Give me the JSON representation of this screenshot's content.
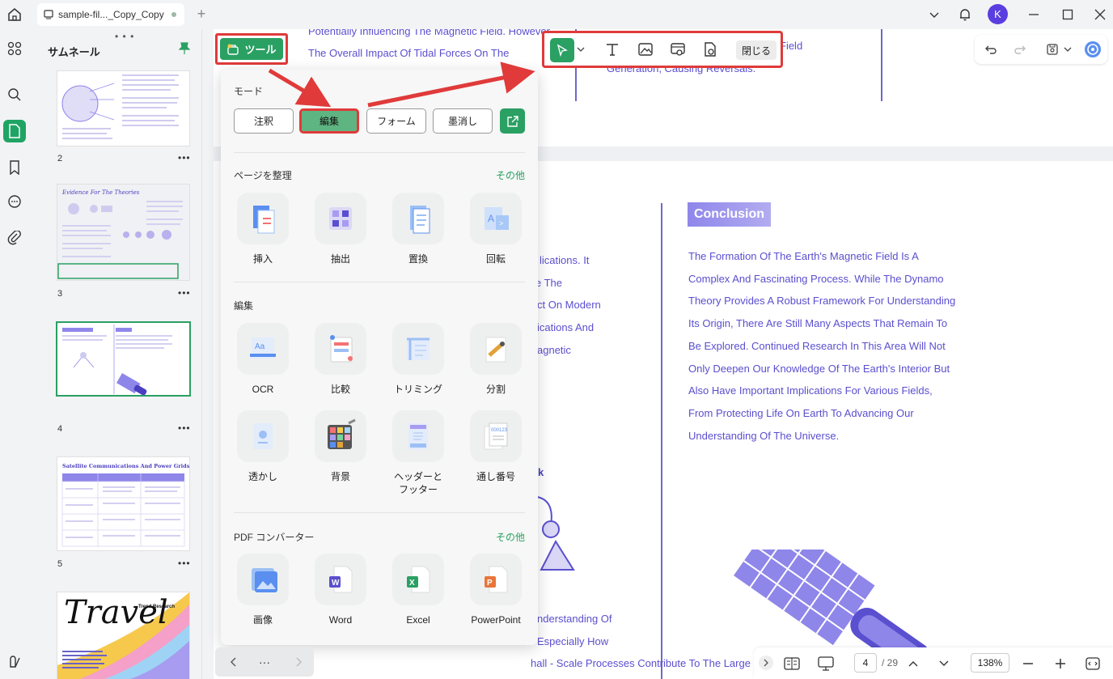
{
  "titlebar": {
    "tab_title": "sample-fil..._Copy_Copy",
    "avatar_letter": "K"
  },
  "thumbnails": {
    "title": "サムネール",
    "pages": [
      {
        "num": "2"
      },
      {
        "num": "3",
        "heading": "Evidence For The Theories"
      },
      {
        "num": "4"
      },
      {
        "num": "5",
        "heading": "Satellite Communications And Power Grids"
      },
      {
        "num": "",
        "heading": "Travel",
        "subheading": "Trend Research"
      }
    ]
  },
  "tool_button": {
    "label": "ツール"
  },
  "edit_toolbar": {
    "close_label": "閉じる"
  },
  "panel": {
    "mode_title": "モード",
    "modes": [
      "注釈",
      "編集",
      "フォーム",
      "墨消し"
    ],
    "organize": {
      "title": "ページを整理",
      "more": "その他",
      "items": [
        "挿入",
        "抽出",
        "置換",
        "回転"
      ]
    },
    "edit": {
      "title": "編集",
      "items": [
        "OCR",
        "比較",
        "トリミング",
        "分割",
        "透かし",
        "背景",
        "ヘッダーと\nフッター",
        "通し番号"
      ]
    },
    "convert": {
      "title": "PDF コンバーター",
      "more": "その他",
      "items": [
        "画像",
        "Word",
        "Excel",
        "PowerPoint"
      ]
    }
  },
  "document": {
    "top_lines": [
      "Potentially Influencing The Magnetic Field. However",
      "The Overall Impact Of Tidal Forces On The"
    ],
    "top_right_lines": [
      "Field",
      "Generation, Causing Reversals."
    ],
    "left_fragments": [
      "lications. It",
      "e The",
      "ct On Modern",
      "ications And",
      "agnetic"
    ],
    "conclusion_title": "Conclusion",
    "conclusion_lines": [
      "The Formation Of The Earth's Magnetic Field Is A",
      "Complex And Fascinating Process. While The Dynamo",
      "Theory Provides A Robust Framework For Understanding",
      "Its Origin, There Are Still Many Aspects That Remain To",
      "Be Explored. Continued Research In This Area Will Not",
      "Only Deepen Our Knowledge Of The Earth's Interior But",
      "Also Have Important Implications For Various Fields,",
      "From Protecting Life On Earth To Advancing Our",
      "Understanding Of The Universe."
    ],
    "bottom_lines": [
      "nderstanding Of",
      "Especially How",
      "hall - Scale Processes Contribute To The Large - Scale Magnetic"
    ],
    "fragment_k": "k"
  },
  "bottom_bar": {
    "current_page": "4",
    "total_pages": "/ 29",
    "zoom": "138%"
  },
  "colors": {
    "accent": "#2aa063",
    "highlight": "#e03a3a",
    "doc_text": "#5a4fcf"
  }
}
